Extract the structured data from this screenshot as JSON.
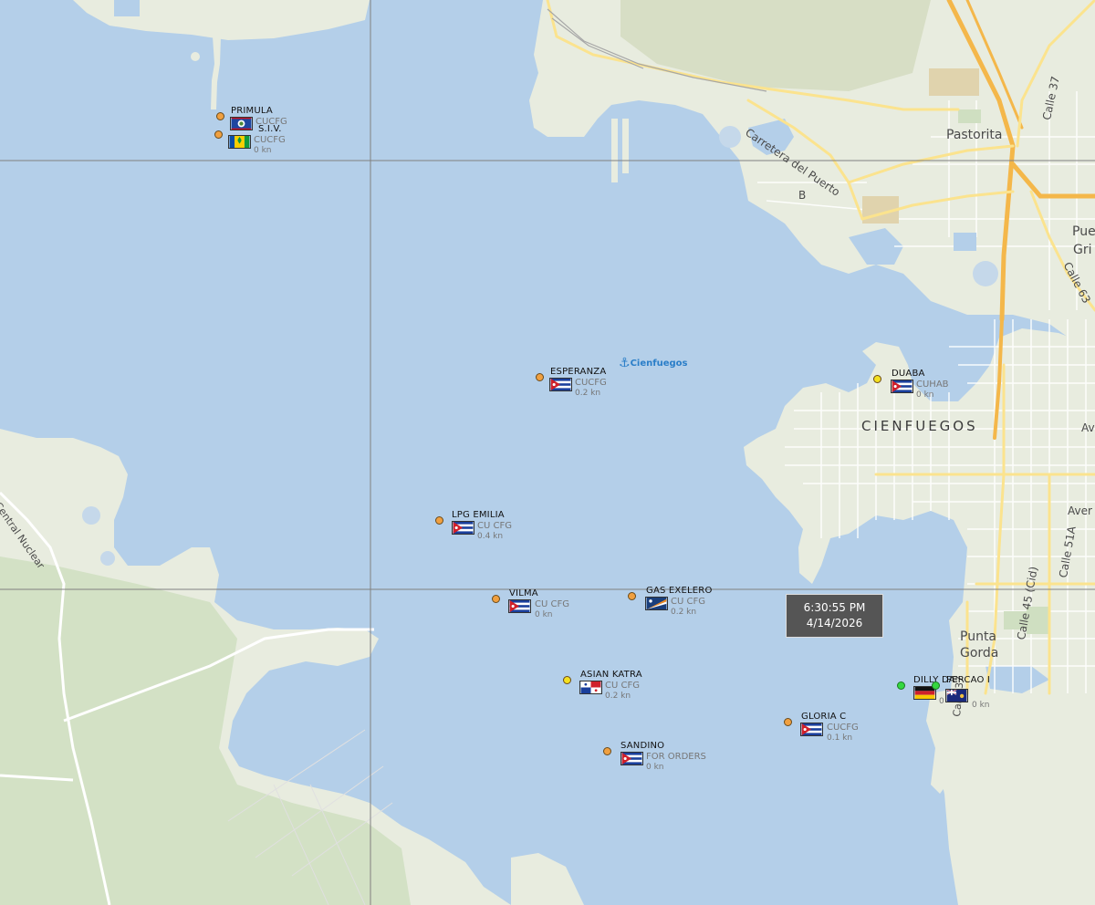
{
  "map": {
    "colors": {
      "water": "#b4cfe9",
      "land": "#e8ecdf",
      "park": "#cfdfc1",
      "road_major": "#f4b74a",
      "road_minor": "#fbe38e",
      "grid_line": "#808080"
    },
    "labels": {
      "city": "CIENFUEGOS",
      "pastorita": "Pastorita",
      "punta_gorda_1": "Punta",
      "punta_gorda_2": "Gorda",
      "carretera": "Carretera del Puerto",
      "central_nuclear": "Central Nuclear",
      "calle_37_top": "Calle 37",
      "calle_63": "Calle 63",
      "calle_45": "Calle 45 (Cid)",
      "calle_51a": "Calle 51A",
      "calle_37_bottom": "Calle 37",
      "pue_gri_1": "Pue",
      "pue_gri_2": "Gri",
      "road_b": "B",
      "ave_1": "Av",
      "ave_2": "Aver"
    }
  },
  "port": {
    "name": "Cienfuegos",
    "icon": "anchor-icon"
  },
  "vessels": [
    {
      "name": "PRIMULA",
      "flag": "belize",
      "destination": "CUCFG",
      "speed": "",
      "status": "orange"
    },
    {
      "name": "S.I.V.",
      "flag": "saint-vincent",
      "destination": "CUCFG",
      "speed": "0 kn",
      "status": "orange"
    },
    {
      "name": "ESPERANZA",
      "flag": "cuba",
      "destination": "CUCFG",
      "speed": "0.2 kn",
      "status": "orange"
    },
    {
      "name": "DUABA",
      "flag": "cuba",
      "destination": "CUHAB",
      "speed": "0 kn",
      "status": "yellow"
    },
    {
      "name": "LPG EMILIA",
      "flag": "cuba",
      "destination": "CU CFG",
      "speed": "0.4 kn",
      "status": "orange"
    },
    {
      "name": "VILMA",
      "flag": "cuba",
      "destination": "CU CFG",
      "speed": "0 kn",
      "status": "orange"
    },
    {
      "name": "GAS EXELERO",
      "flag": "marshall-islands",
      "destination": "CU CFG",
      "speed": "0.2 kn",
      "status": "orange"
    },
    {
      "name": "ASIAN KATRA",
      "flag": "panama",
      "destination": "CU CFG",
      "speed": "0.2 kn",
      "status": "yellow"
    },
    {
      "name": "GLORIA C",
      "flag": "cuba",
      "destination": "CUCFG",
      "speed": "0.1 kn",
      "status": "orange"
    },
    {
      "name": "SANDINO",
      "flag": "cuba",
      "destination": "FOR ORDERS",
      "speed": "0 kn",
      "status": "orange"
    },
    {
      "name": "DILLY DA",
      "flag": "germany",
      "destination": "",
      "speed": "0",
      "status": "green"
    },
    {
      "name": "PERCAO I",
      "flag": "cayman",
      "destination": "",
      "speed": "0 kn",
      "status": "green"
    }
  ],
  "tooltip": {
    "time": "6:30:55 PM",
    "date": "4/14/2026"
  }
}
